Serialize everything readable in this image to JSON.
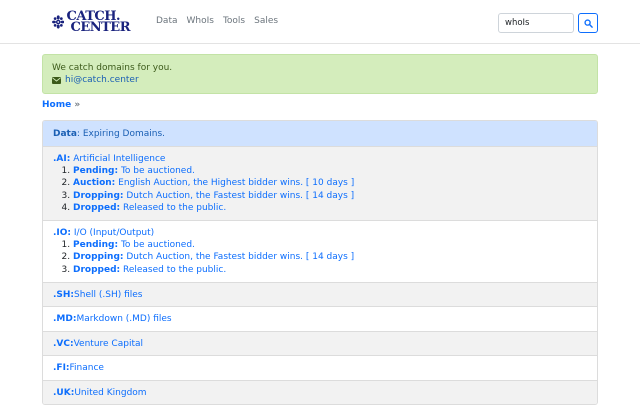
{
  "brand": {
    "line1": "CATCH.",
    "line2": "CENTER"
  },
  "nav": {
    "links": [
      "Data",
      "WhoIs",
      "Tools",
      "Sales"
    ]
  },
  "search": {
    "value": "whoIs",
    "button_icon": "search-icon"
  },
  "alert": {
    "message": "We catch domains for you.",
    "email": "hi@catch.center",
    "icon": "envelope-icon"
  },
  "breadcrumb": {
    "home": "Home",
    "sep": "»"
  },
  "header": {
    "label": "Data",
    "rest": ": Expiring Domains."
  },
  "tlds": [
    {
      "tld": ".AI:",
      "desc": " Artificial Intelligence",
      "steps": [
        {
          "label": "Pending:",
          "text": " To be auctioned."
        },
        {
          "label": "Auction:",
          "text": " English Auction, the Highest bidder wins. [ 10 days ]"
        },
        {
          "label": "Dropping:",
          "text": " Dutch Auction, the Fastest bidder wins. [ 14 days ]"
        },
        {
          "label": "Dropped:",
          "text": " Released to the public."
        }
      ]
    },
    {
      "tld": ".IO:",
      "desc": " I/O (Input/Output)",
      "steps": [
        {
          "label": "Pending:",
          "text": " To be auctioned."
        },
        {
          "label": "Dropping:",
          "text": " Dutch Auction, the Fastest bidder wins. [ 14 days ]"
        },
        {
          "label": "Dropped:",
          "text": " Released to the public."
        }
      ]
    },
    {
      "tld": ".SH:",
      "desc": " Shell (.SH) files"
    },
    {
      "tld": ".MD:",
      "desc": " Markdown (.MD) files"
    },
    {
      "tld": ".VC:",
      "desc": " Venture Capital"
    },
    {
      "tld": ".FI:",
      "desc": " Finance"
    },
    {
      "tld": ".UK:",
      "desc": " United Kingdom"
    }
  ],
  "colors": {
    "link": "#0d6efd",
    "alert_bg": "#d4edbc",
    "header_bg": "#cfe2ff",
    "row_alt_bg": "#f2f2f2"
  }
}
